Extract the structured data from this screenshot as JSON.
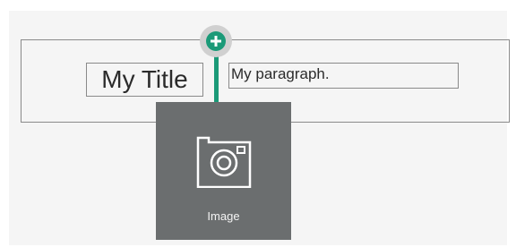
{
  "editor": {
    "title_block_text": "My Title",
    "paragraph_block_text": "My paragraph."
  },
  "add_block": {
    "icon": "plus-icon",
    "accent_color": "#1b9a78"
  },
  "block_menu": {
    "image_item": {
      "label": "Image",
      "icon": "camera-icon"
    }
  }
}
